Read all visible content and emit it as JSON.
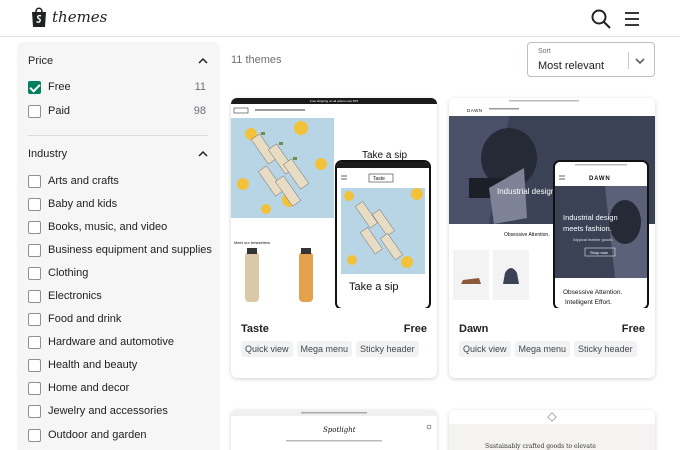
{
  "header": {
    "brand": "themes",
    "logo_icon": "shopify-bag-icon",
    "search_icon": "search-icon",
    "menu_icon": "hamburger-menu-icon"
  },
  "sidebar": {
    "price": {
      "title": "Price",
      "items": [
        {
          "label": "Free",
          "count": "11",
          "checked": true
        },
        {
          "label": "Paid",
          "count": "98",
          "checked": false
        }
      ]
    },
    "industry": {
      "title": "Industry",
      "items": [
        {
          "label": "Arts and crafts"
        },
        {
          "label": "Baby and kids"
        },
        {
          "label": "Books, music, and video"
        },
        {
          "label": "Business equipment and supplies"
        },
        {
          "label": "Clothing"
        },
        {
          "label": "Electronics"
        },
        {
          "label": "Food and drink"
        },
        {
          "label": "Hardware and automotive"
        },
        {
          "label": "Health and beauty"
        },
        {
          "label": "Home and decor"
        },
        {
          "label": "Jewelry and accessories"
        },
        {
          "label": "Outdoor and garden"
        }
      ]
    }
  },
  "main": {
    "count_text": "11 themes",
    "sort": {
      "caption": "Sort",
      "value": "Most relevant"
    },
    "themes": [
      {
        "name": "Taste",
        "price": "Free",
        "tags": [
          "Quick view",
          "Mega menu",
          "Sticky header"
        ],
        "preview": {
          "promo": "Free shipping on all orders over $75",
          "headline": "Take a sip",
          "section": "Meet our bestsellers",
          "logo": "Taste"
        }
      },
      {
        "name": "Dawn",
        "price": "Free",
        "tags": [
          "Quick view",
          "Mega menu",
          "Sticky header"
        ],
        "preview": {
          "logo": "DAWN",
          "headline": "Industrial design meets fashion.",
          "subline": "Atypical leather goods",
          "cta": "Shop now",
          "tagline": "Obsessive Attention. Intelligent Effort."
        }
      },
      {
        "preview": {
          "logo": "Spotlight"
        }
      },
      {
        "preview": {
          "headline": "Sustainably crafted goods to elevate"
        }
      }
    ]
  },
  "colors": {
    "accent": "#008060",
    "sidebar_bg": "#f6f6f7",
    "dawn_dark": "#3b4256"
  }
}
